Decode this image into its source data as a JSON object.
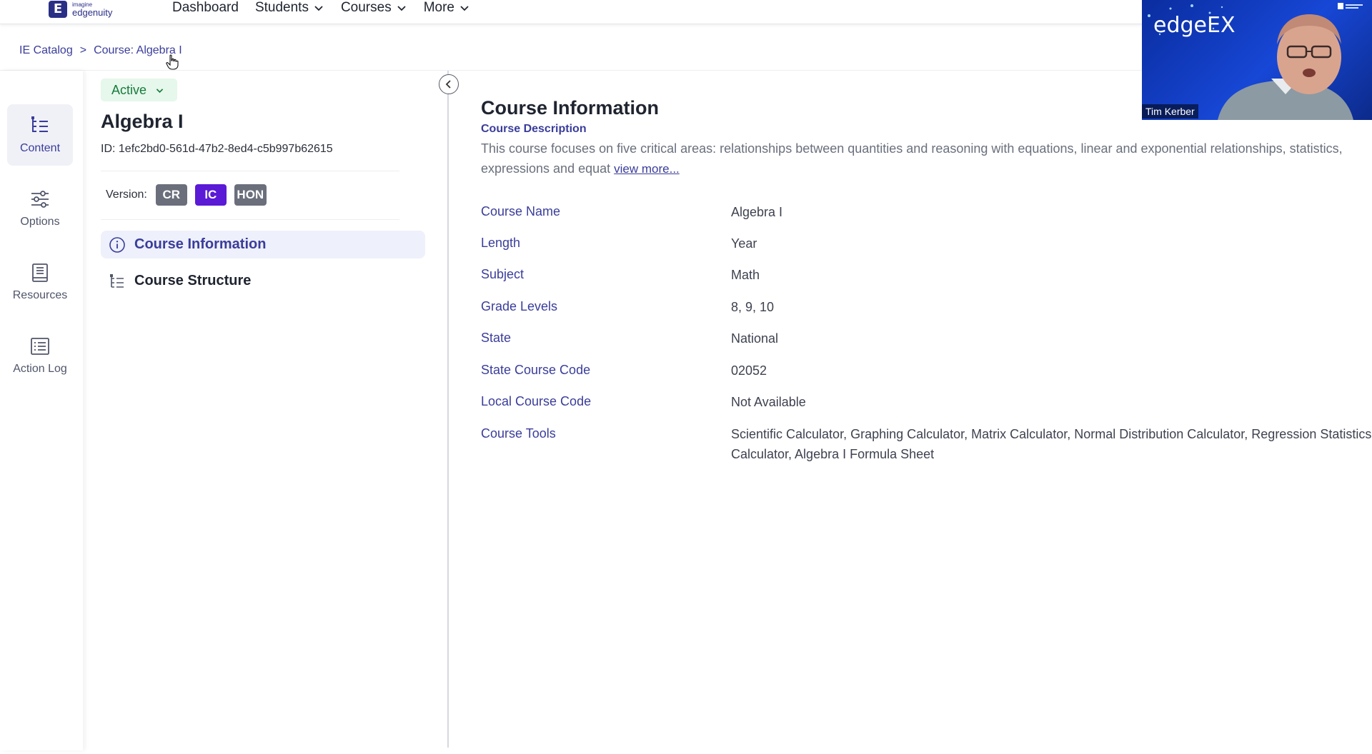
{
  "nav": {
    "logo_top": "imagine",
    "logo_bottom": "edgenuity",
    "items": [
      {
        "label": "Dashboard",
        "dropdown": false
      },
      {
        "label": "Students",
        "dropdown": true
      },
      {
        "label": "Courses",
        "dropdown": true
      },
      {
        "label": "More",
        "dropdown": true
      }
    ]
  },
  "breadcrumb": {
    "catalog": "IE Catalog",
    "separator": ">",
    "current": "Course: Algebra I"
  },
  "rail": {
    "items": [
      {
        "label": "Content",
        "icon": "content-tree-icon",
        "active": true
      },
      {
        "label": "Options",
        "icon": "sliders-icon",
        "active": false
      },
      {
        "label": "Resources",
        "icon": "book-icon",
        "active": false
      },
      {
        "label": "Action Log",
        "icon": "list-icon",
        "active": false
      }
    ]
  },
  "course": {
    "status": "Active",
    "title": "Algebra I",
    "id_text": "ID: 1efc2bd0-561d-47b2-8ed4-c5b997b62615",
    "version_label": "Version:",
    "versions": [
      {
        "label": "CR",
        "selected": false
      },
      {
        "label": "IC",
        "selected": true
      },
      {
        "label": "HON",
        "selected": false
      }
    ],
    "sections": [
      {
        "label": "Course Information",
        "icon": "info-icon",
        "active": true
      },
      {
        "label": "Course Structure",
        "icon": "structure-tree-icon",
        "active": false
      }
    ]
  },
  "main": {
    "title": "Course Information",
    "description_label": "Course Description",
    "description": "This course focuses on five critical areas: relationships between quantities and reasoning with equations, linear and exponential relationships, statistics, expressions and equat",
    "view_more": "view more...",
    "fields": [
      {
        "label": "Course Name",
        "value": "Algebra I"
      },
      {
        "label": "Length",
        "value": "Year"
      },
      {
        "label": "Subject",
        "value": "Math"
      },
      {
        "label": "Grade Levels",
        "value": "8, 9, 10"
      },
      {
        "label": "State",
        "value": "National"
      },
      {
        "label": "State Course Code",
        "value": "02052"
      },
      {
        "label": "Local Course Code",
        "value": "Not Available"
      },
      {
        "label": "Course Tools",
        "value": "Scientific Calculator, Graphing Calculator, Matrix Calculator, Normal Distribution Calculator, Regression Statistics Calculator, Algebra I Formula Sheet"
      }
    ]
  },
  "video": {
    "brand": "edgeEX",
    "participant": "Tim Kerber"
  },
  "colors": {
    "primary": "#3a3d9a",
    "accent_purple": "#5a1ad6",
    "status_green": "#167b3a",
    "status_bg": "#e6f7ec",
    "video_blue": "#1747d6"
  }
}
